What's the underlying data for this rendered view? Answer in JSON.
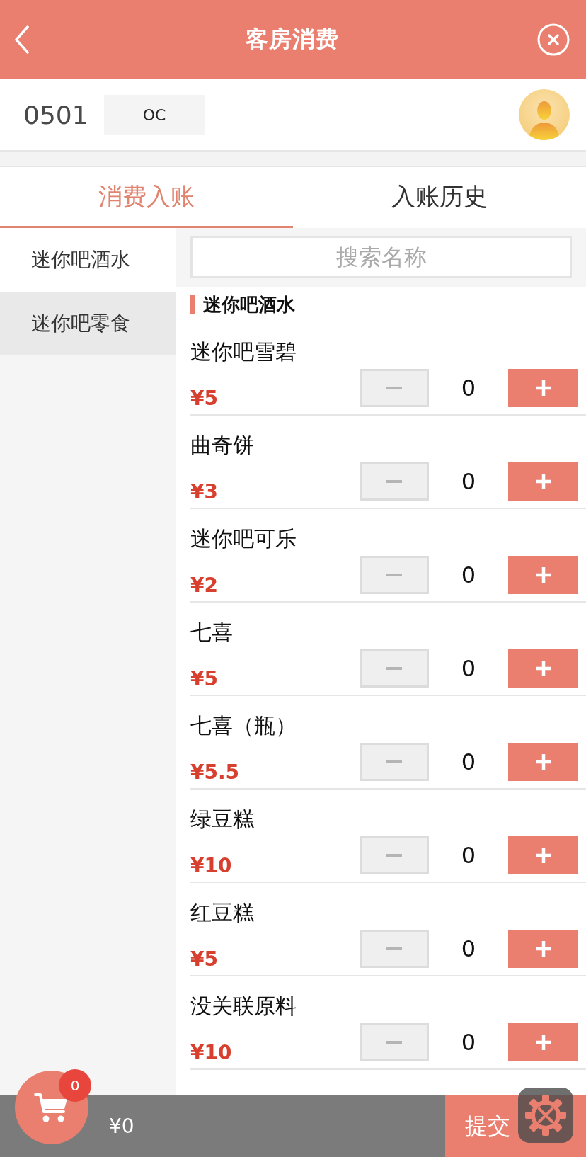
{
  "header": {
    "title": "客房消费"
  },
  "room": {
    "number": "0501",
    "status": "OC"
  },
  "tabs": [
    {
      "label": "消费入账",
      "selected": true
    },
    {
      "label": "入账历史",
      "selected": false
    }
  ],
  "categories": [
    {
      "label": "迷你吧酒水",
      "selected": true
    },
    {
      "label": "迷你吧零食",
      "selected": false
    }
  ],
  "search": {
    "placeholder": "搜索名称"
  },
  "section": {
    "title": "迷你吧酒水"
  },
  "items": [
    {
      "name": "迷你吧雪碧",
      "price": "¥5",
      "quantity": "0"
    },
    {
      "name": "曲奇饼",
      "price": "¥3",
      "quantity": "0"
    },
    {
      "name": "迷你吧可乐",
      "price": "¥2",
      "quantity": "0"
    },
    {
      "name": "七喜",
      "price": "¥5",
      "quantity": "0"
    },
    {
      "name": "七喜（瓶）",
      "price": "¥5.5",
      "quantity": "0"
    },
    {
      "name": "绿豆糕",
      "price": "¥10",
      "quantity": "0"
    },
    {
      "name": "红豆糕",
      "price": "¥5",
      "quantity": "0"
    },
    {
      "name": "没关联原料",
      "price": "¥10",
      "quantity": "0"
    }
  ],
  "cart": {
    "badge": "0",
    "total": "¥0"
  },
  "submit": {
    "label": "提交"
  }
}
